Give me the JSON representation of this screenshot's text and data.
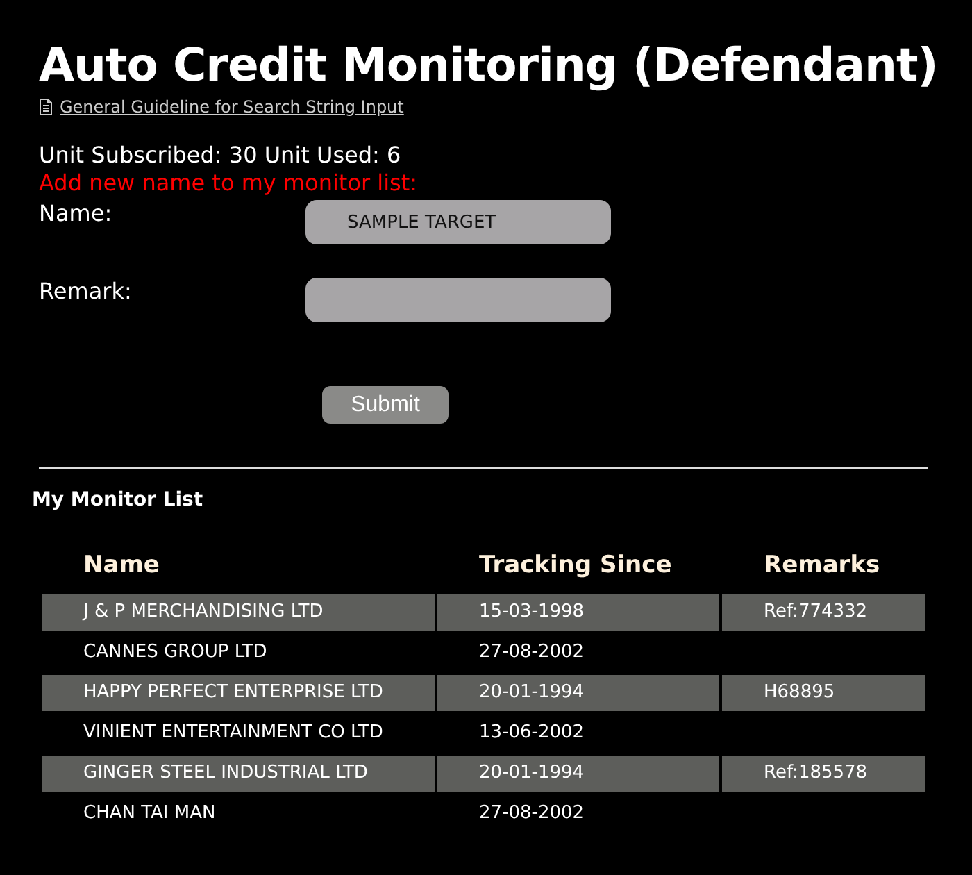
{
  "title": "Auto Credit Monitoring (Defendant)",
  "guideline_link": "General Guideline for Search String Input",
  "units": "Unit Subscribed: 30 Unit Used: 6",
  "add_prompt": "Add new name to my monitor list:",
  "form": {
    "name_label": "Name:",
    "name_value": "SAMPLE TARGET",
    "remark_label": "Remark:",
    "submit": "Submit"
  },
  "monitor_list": {
    "heading": "My Monitor List",
    "columns": [
      "Name",
      "Tracking Since",
      "Remarks"
    ],
    "rows": [
      {
        "name": "J & P MERCHANDISING LTD",
        "since": "15-03-1998",
        "remark": "Ref:774332"
      },
      {
        "name": "CANNES GROUP LTD",
        "since": "27-08-2002"
      },
      {
        "name": "HAPPY PERFECT ENTERPRISE LTD",
        "since": "20-01-1994",
        "remark": "H68895"
      },
      {
        "name": "VINIENT ENTERTAINMENT CO LTD",
        "since": "13-06-2002"
      },
      {
        "name": "GINGER STEEL INDUSTRIAL LTD",
        "since": "20-01-1994",
        "remark": "Ref:185578"
      },
      {
        "name": "CHAN TAI MAN",
        "since": "27-08-2002"
      }
    ]
  }
}
